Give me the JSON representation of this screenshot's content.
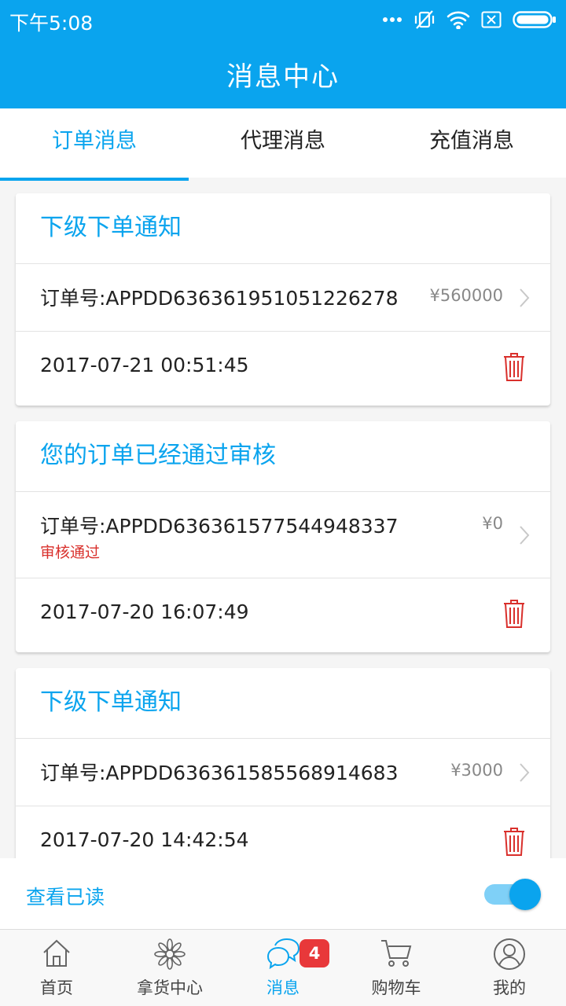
{
  "status_bar": {
    "time": "下午5:08",
    "icons": [
      "more-dots-icon",
      "vibrate-off-icon",
      "wifi-icon",
      "sim-off-icon",
      "battery-icon"
    ]
  },
  "header": {
    "title": "消息中心"
  },
  "tabs": [
    {
      "label": "订单消息",
      "active": true
    },
    {
      "label": "代理消息",
      "active": false
    },
    {
      "label": "充值消息",
      "active": false
    }
  ],
  "messages": [
    {
      "title": "下级下单通知",
      "order_no": "订单号:APPDD636361951051226278",
      "price": "¥560000",
      "status": "",
      "date": "2017-07-21 00:51:45"
    },
    {
      "title": "您的订单已经通过审核",
      "order_no": "订单号:APPDD636361577544948337",
      "price": "¥0",
      "status": "审核通过",
      "date": "2017-07-20 16:07:49"
    },
    {
      "title": "下级下单通知",
      "order_no": "订单号:APPDD636361585568914683",
      "price": "¥3000",
      "status": "",
      "date": "2017-07-20 14:42:54"
    }
  ],
  "read_toggle": {
    "label": "查看已读",
    "on": true
  },
  "bottom_nav": [
    {
      "label": "首页",
      "icon": "home-icon",
      "active": false
    },
    {
      "label": "拿货中心",
      "icon": "flower-icon",
      "active": false
    },
    {
      "label": "消息",
      "icon": "chat-bubbles-icon",
      "active": true,
      "badge": "4"
    },
    {
      "label": "购物车",
      "icon": "cart-icon",
      "active": false
    },
    {
      "label": "我的",
      "icon": "profile-icon",
      "active": false
    }
  ],
  "colors": {
    "primary": "#0aa4ee",
    "delete": "#d9302c",
    "badge": "#e8383a"
  }
}
